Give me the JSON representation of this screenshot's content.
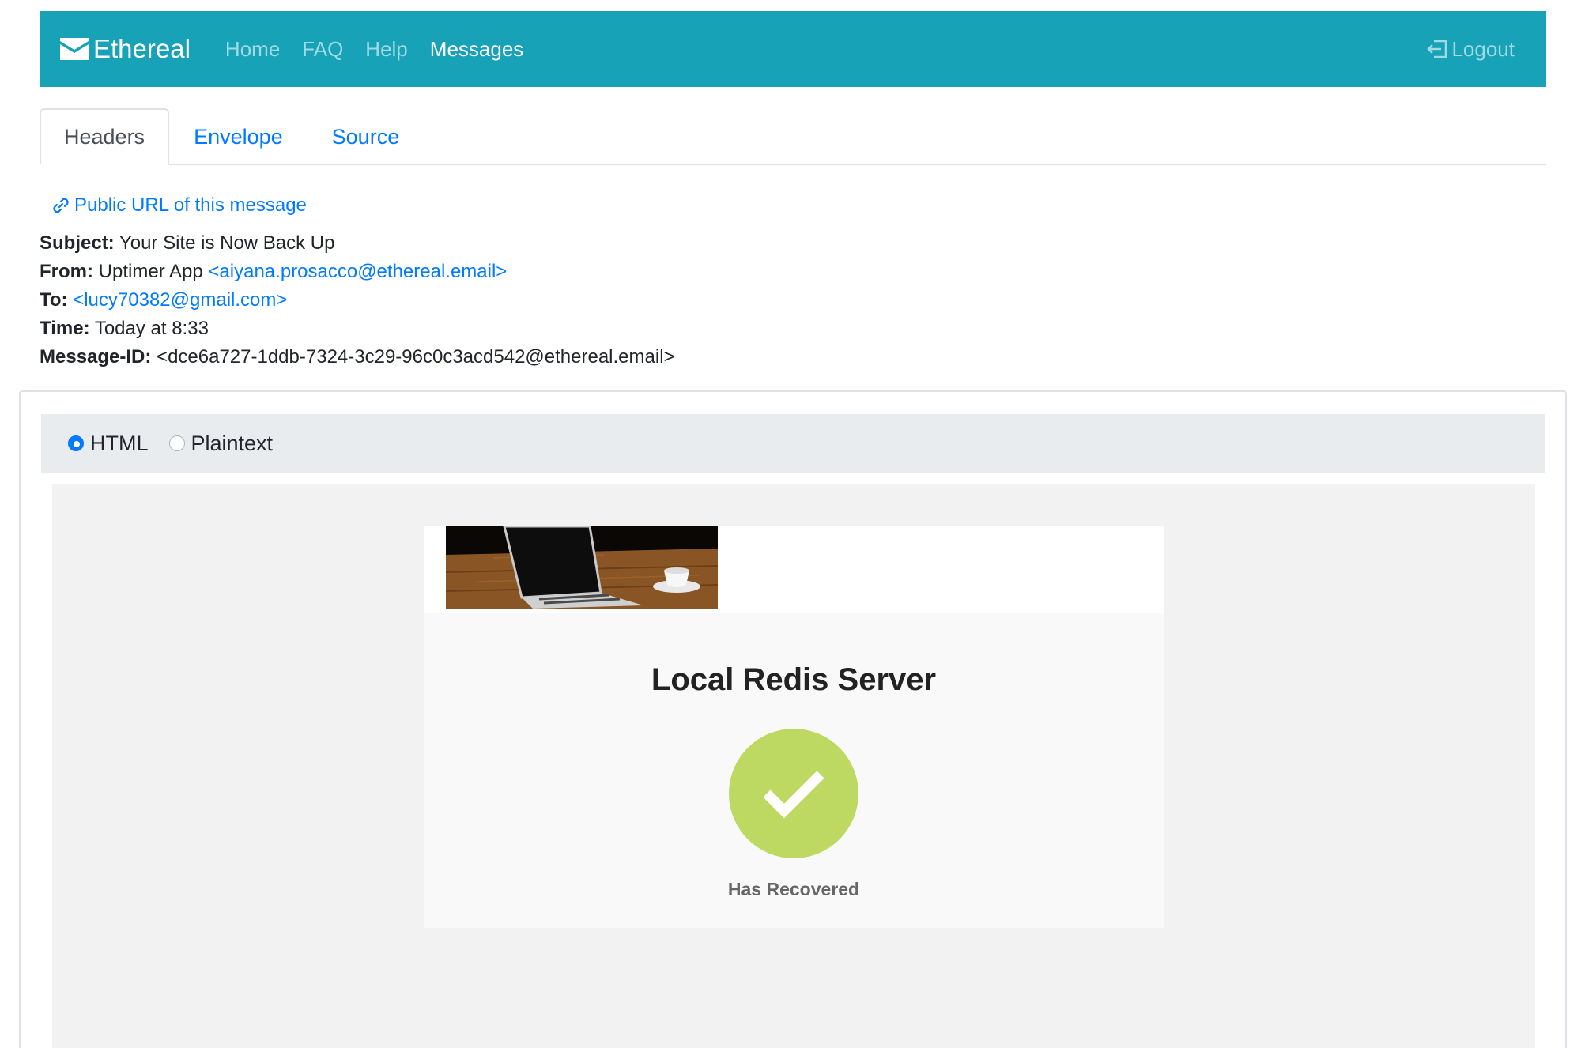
{
  "navbar": {
    "brand": "Ethereal",
    "links": [
      "Home",
      "FAQ",
      "Help",
      "Messages"
    ],
    "active_link": "Messages",
    "logout": "Logout",
    "color": "#17a2b8"
  },
  "tabs": [
    {
      "label": "Headers",
      "active": true
    },
    {
      "label": "Envelope",
      "active": false
    },
    {
      "label": "Source",
      "active": false
    }
  ],
  "message": {
    "public_url_label": "Public URL of this message",
    "subject_label": "Subject:",
    "subject": "Your Site is Now Back Up",
    "from_label": "From:",
    "from_name": "Uptimer App",
    "from_email": "<aiyana.prosacco@ethereal.email>",
    "to_label": "To:",
    "to_email": "<lucy70382@gmail.com>",
    "time_label": "Time:",
    "time": "Today at 8:33",
    "message_id_label": "Message-ID:",
    "message_id": "<dce6a727-1ddb-7324-3c29-96c0c3acd542@ethereal.email>"
  },
  "format": {
    "options": [
      "HTML",
      "Plaintext"
    ],
    "selected": "HTML"
  },
  "email_body": {
    "title": "Local Redis Server",
    "status": "Has Recovered",
    "status_color": "#bdd961",
    "hero_image": "laptop-on-wooden-table"
  }
}
